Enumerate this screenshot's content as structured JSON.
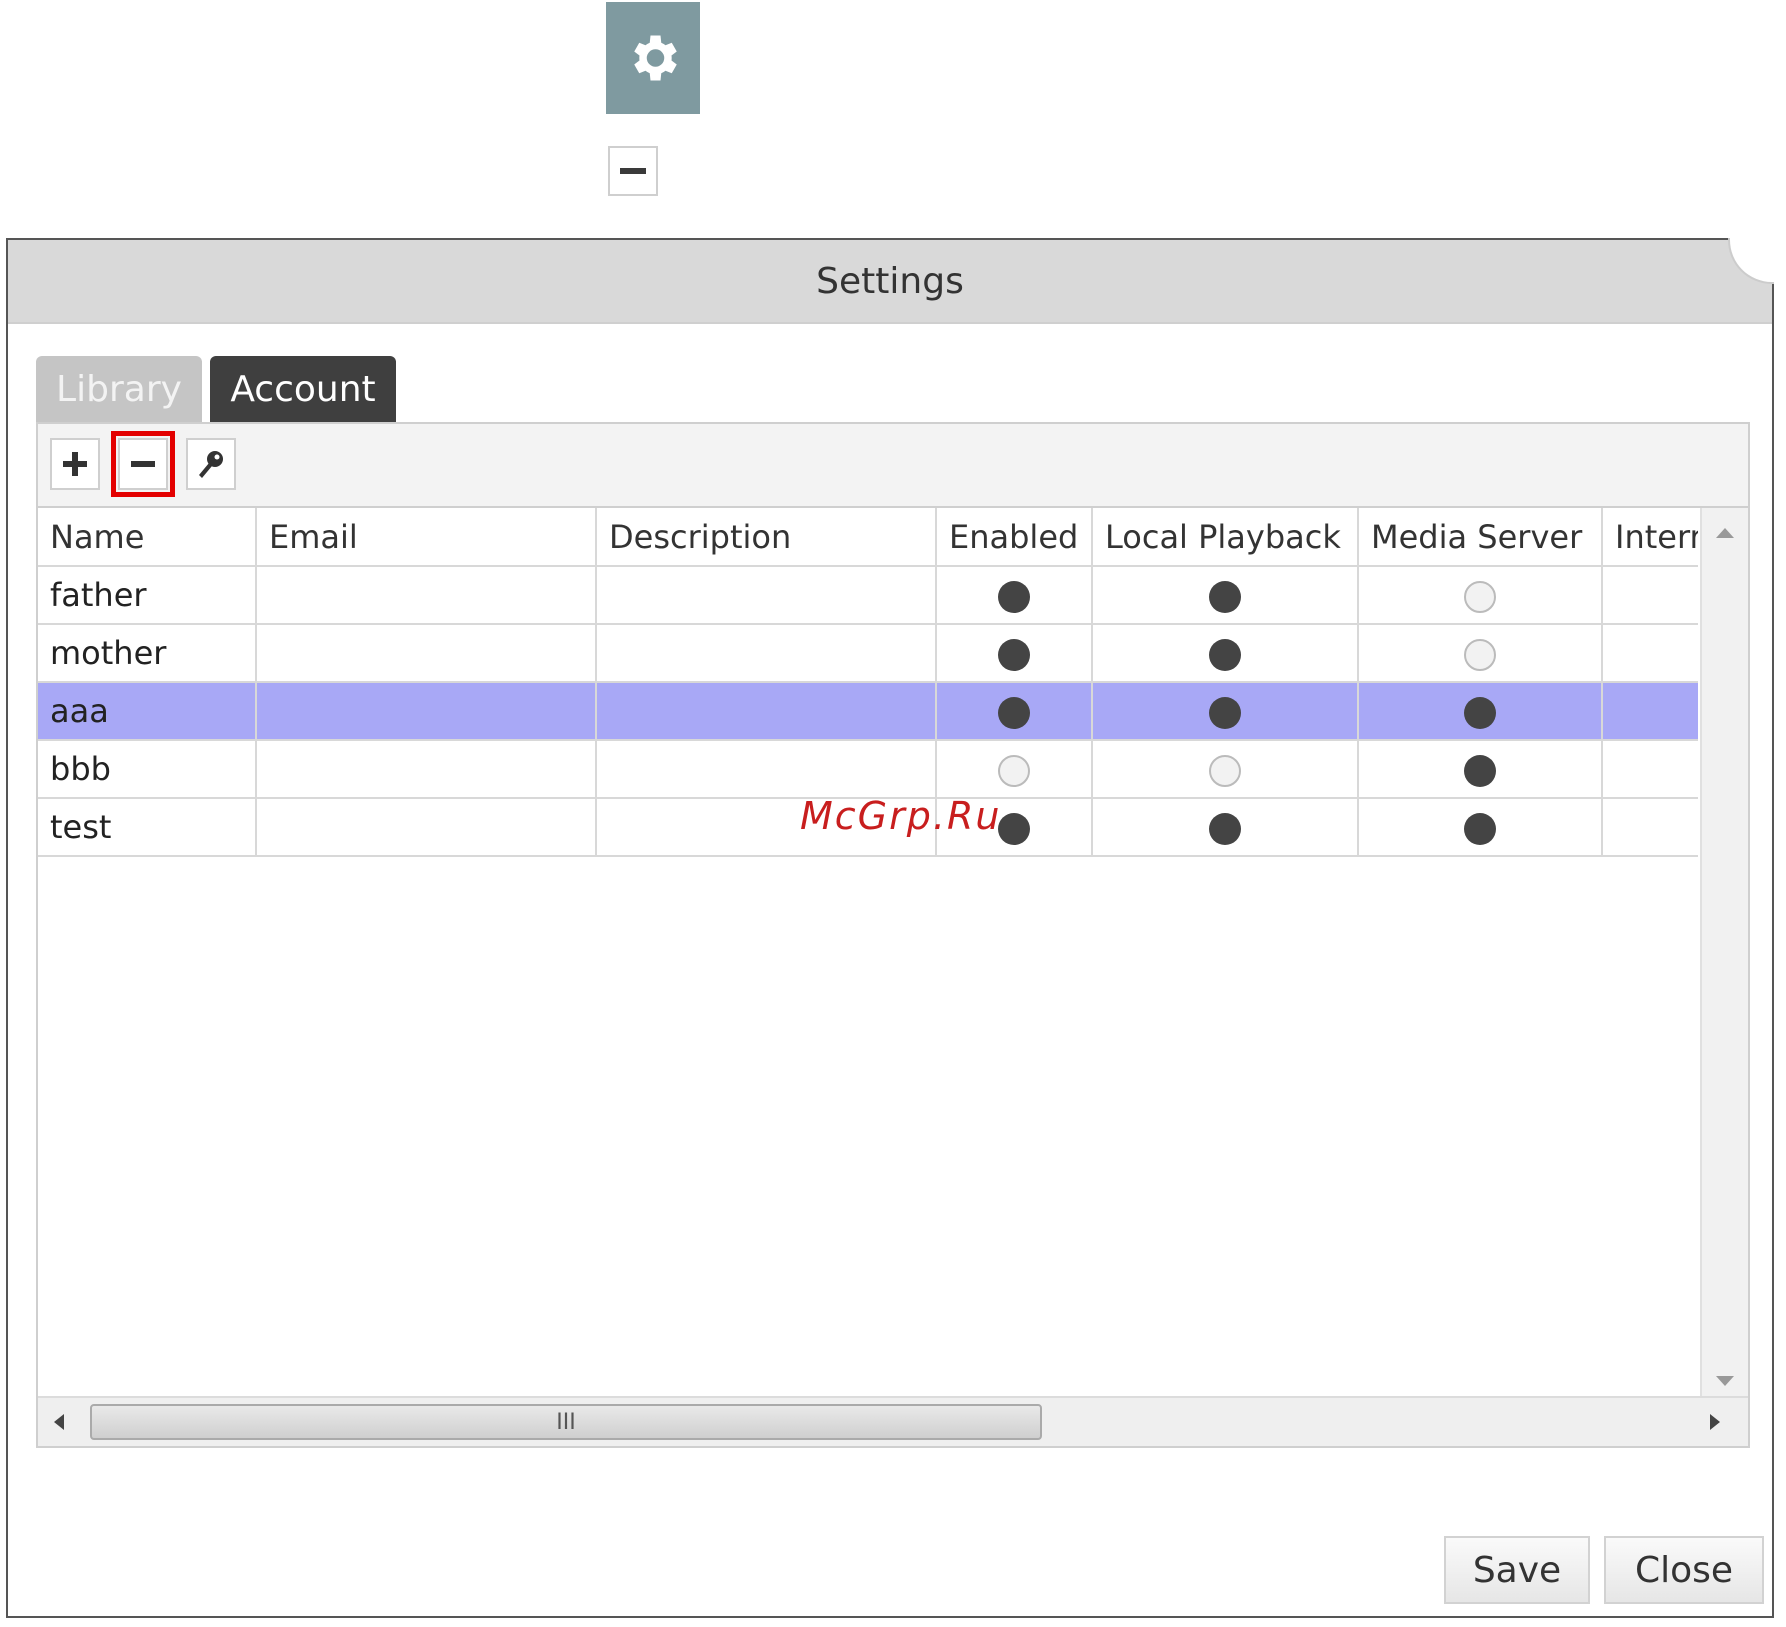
{
  "dialog": {
    "title": "Settings"
  },
  "tabs": [
    {
      "label": "Library",
      "active": false
    },
    {
      "label": "Account",
      "active": true
    }
  ],
  "toolbar": {
    "add_icon": "plus-icon",
    "remove_icon": "minus-icon",
    "edit_icon": "key-icon",
    "highlight_color": "#e30000"
  },
  "table": {
    "columns": [
      "Name",
      "Email",
      "Description",
      "Enabled",
      "Local Playback",
      "Media Server",
      "Interr"
    ],
    "rows": [
      {
        "name": "father",
        "email": "",
        "description": "",
        "enabled": true,
        "local_playback": true,
        "media_server": false,
        "selected": false
      },
      {
        "name": "mother",
        "email": "",
        "description": "",
        "enabled": true,
        "local_playback": true,
        "media_server": false,
        "selected": false
      },
      {
        "name": "aaa",
        "email": "",
        "description": "",
        "enabled": true,
        "local_playback": true,
        "media_server": true,
        "selected": true
      },
      {
        "name": "bbb",
        "email": "",
        "description": "",
        "enabled": false,
        "local_playback": false,
        "media_server": true,
        "selected": false
      },
      {
        "name": "test",
        "email": "",
        "description": "",
        "enabled": true,
        "local_playback": true,
        "media_server": true,
        "selected": false
      }
    ],
    "selected_color": "#a8a8f6"
  },
  "scrollbar": {
    "thumb_grip": "III"
  },
  "buttons": {
    "save": "Save",
    "close": "Close"
  },
  "watermark": "McGrp.Ru"
}
